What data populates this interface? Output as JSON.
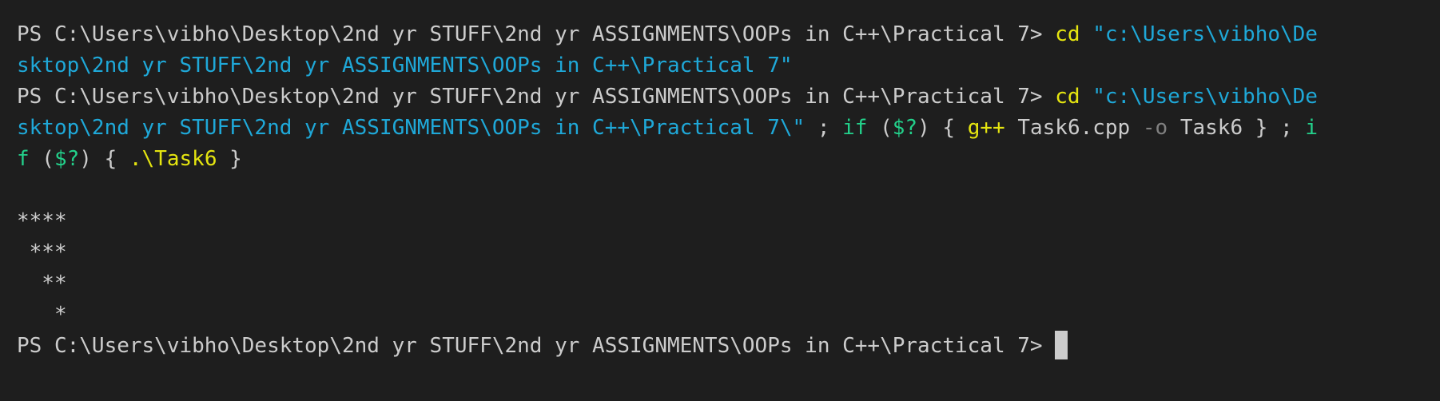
{
  "terminal": {
    "prompt": "PS C:\\Users\\vibho\\Desktop\\2nd yr STUFF\\2nd yr ASSIGNMENTS\\OOPs in C++\\Practical 7> ",
    "line1": {
      "cmd": "cd",
      "space": " ",
      "path_part1": "\"c:\\Users\\vibho\\De"
    },
    "line2": {
      "path_part2": "sktop\\2nd yr STUFF\\2nd yr ASSIGNMENTS\\OOPs in C++\\Practical 7\""
    },
    "line3": {
      "cmd": "cd",
      "space": " ",
      "path_part1": "\"c:\\Users\\vibho\\De"
    },
    "line4": {
      "path_part2": "sktop\\2nd yr STUFF\\2nd yr ASSIGNMENTS\\OOPs in C++\\Practical 7\\\"",
      "sep1": " ; ",
      "kw_if": "if",
      "open_paren": " (",
      "status_var": "$?",
      "close_brace_open": ") { ",
      "compiler": "g++",
      "source_file": " Task6.cpp ",
      "flag": "-o",
      "output_file": " Task6 ",
      "close_brace": "} ; ",
      "kw_i": "i"
    },
    "line5": {
      "kw_f": "f",
      "open_paren": " (",
      "status_var": "$?",
      "close_brace_open": ") { ",
      "exec": ".\\Task6",
      "close_brace": " }"
    },
    "output": [
      "****",
      " ***",
      "  **",
      "   *"
    ],
    "final_prompt": "PS C:\\Users\\vibho\\Desktop\\2nd yr STUFF\\2nd yr ASSIGNMENTS\\OOPs in C++\\Practical 7> "
  },
  "colors": {
    "background": "#1e1e1e",
    "text": "#cccccc",
    "command": "#e5e510",
    "string": "#1fa8d8",
    "keyword": "#23d18b",
    "flag": "#808080"
  }
}
